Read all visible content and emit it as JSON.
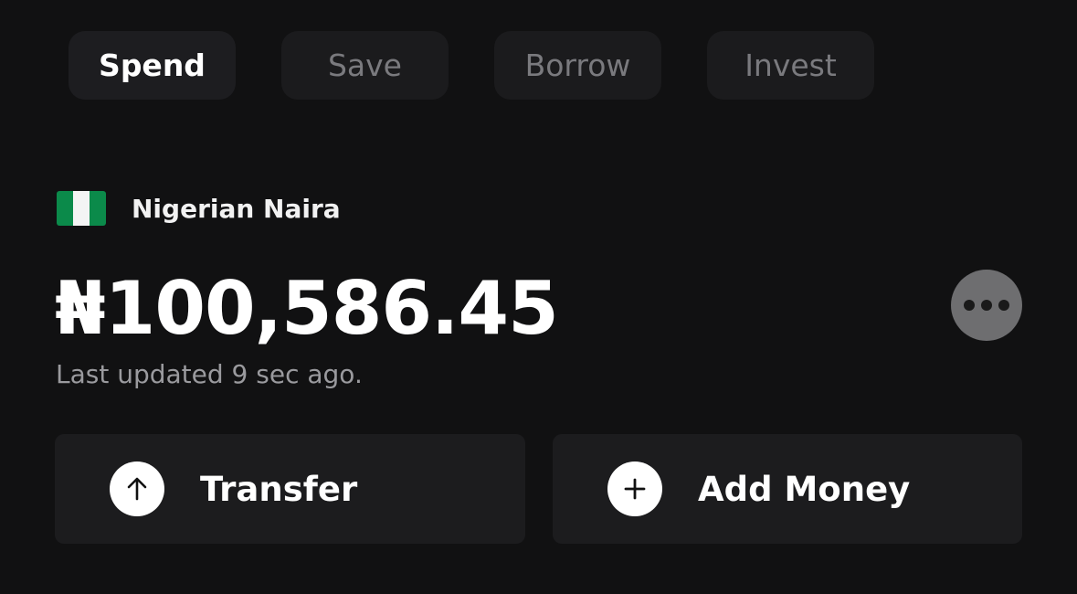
{
  "tabs": [
    {
      "label": "Spend",
      "active": true
    },
    {
      "label": "Save",
      "active": false
    },
    {
      "label": "Borrow",
      "active": false
    },
    {
      "label": "Invest",
      "active": false
    }
  ],
  "account": {
    "currency_flag": "nigeria-flag-icon",
    "currency_name": "Nigerian Naira",
    "balance": "₦100,586.45",
    "last_updated": "Last updated 9 sec ago."
  },
  "actions": {
    "transfer": {
      "label": "Transfer",
      "icon": "arrow-up-icon"
    },
    "add_money": {
      "label": "Add Money",
      "icon": "plus-icon"
    }
  },
  "more": {
    "icon": "more-horizontal-icon"
  },
  "colors": {
    "background": "#111112",
    "card": "#1c1c1e",
    "flag_green": "#0b8a4a",
    "muted_text": "#9a9a9e"
  }
}
